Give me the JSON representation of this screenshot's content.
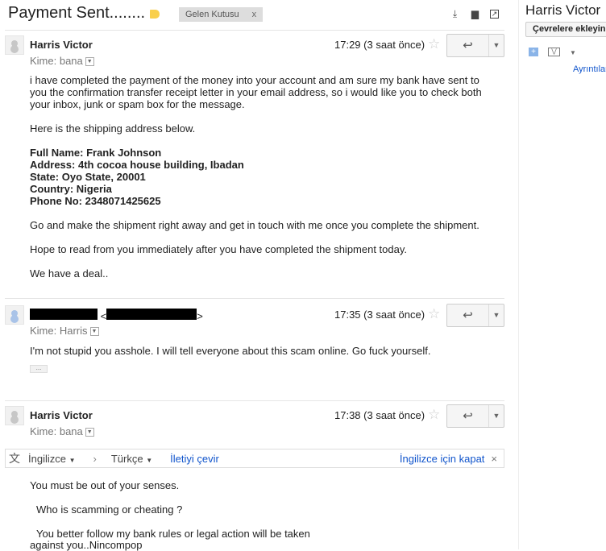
{
  "subject": "Payment Sent........",
  "label": {
    "name": "Gelen Kutusu",
    "remove": "x",
    "color": "#f9cf4c"
  },
  "toolbar_icons": [
    "download-icon",
    "print-icon",
    "new-window-icon"
  ],
  "messages": [
    {
      "sender": "Harris Victor",
      "time": "17:29 (3 saat önce)",
      "to": "Kime: bana",
      "paragraphs": [
        "i have completed the payment of the money into your account and am sure my bank have sent to you the confirmation transfer receipt letter in your email address, so i would like you to check both your inbox, junk or spam box for the message.",
        "Here is the shipping address below."
      ],
      "address": [
        "Full Name: Frank Johnson",
        "Address: 4th cocoa house building, Ibadan",
        "State: Oyo State, 20001",
        "Country: Nigeria",
        "Phone No: 2348071425625"
      ],
      "paragraphs2": [
        "Go and make the shipment right away and get in touch with me once you complete the shipment.",
        "Hope to read from you immediately after you have completed the shipment today.",
        "We have a deal.."
      ]
    },
    {
      "sender": "",
      "email_open": "<",
      "email_close": ">",
      "time": "17:35 (3 saat önce)",
      "to": "Kime: Harris",
      "text": "I'm not stupid you asshole. I will tell everyone about this scam online. Go fuck yourself.",
      "expand": "..."
    },
    {
      "sender": "Harris Victor",
      "time": "17:38 (3 saat önce)",
      "to": "Kime: bana",
      "translate": {
        "from": "İngilizce",
        "to": "Türkçe",
        "action": "İletiyi çevir",
        "close": "İngilizce için kapat",
        "close_x": "×"
      },
      "lines": [
        "You must be out of your senses.",
        "Who is scamming or cheating ?",
        "You better follow my bank rules or legal action will be taken",
        "against you..Nincompop"
      ]
    }
  ],
  "sidebar": {
    "name": "Harris Victor",
    "add_button": "Çevrelere ekleyin",
    "details": "Ayrıntılar"
  }
}
